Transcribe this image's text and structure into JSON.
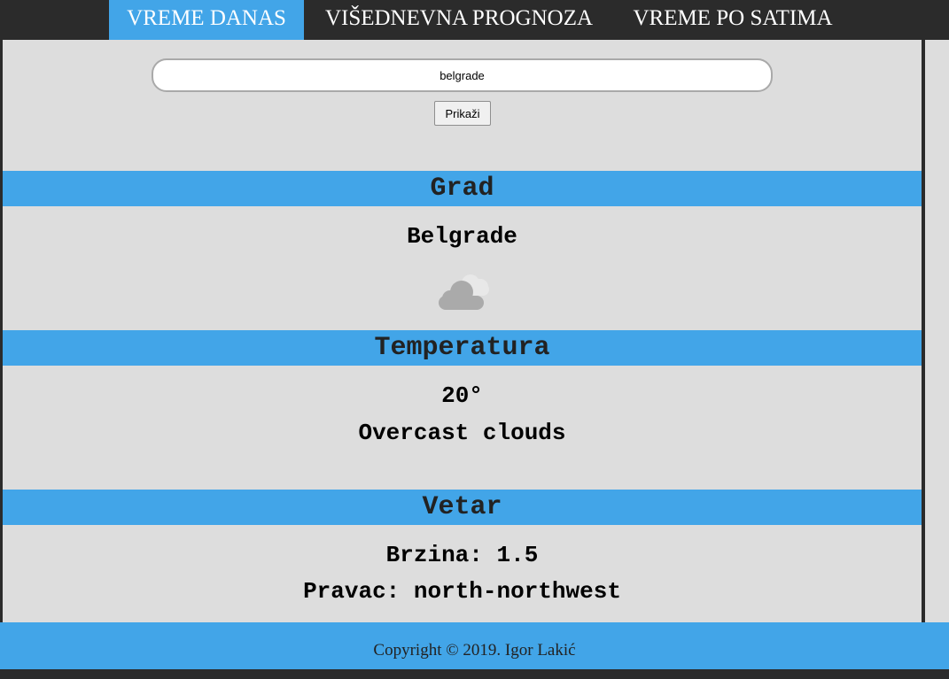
{
  "nav": {
    "tabs": [
      {
        "label": "VREME DANAS",
        "active": true
      },
      {
        "label": "VIŠEDNEVNA PROGNOZA",
        "active": false
      },
      {
        "label": "VREME PO SATIMA",
        "active": false
      }
    ]
  },
  "search": {
    "value": "belgrade",
    "button_label": "Prikaži"
  },
  "sections": {
    "city": {
      "heading": "Grad",
      "name": "Belgrade",
      "icon": "overcast-cloud-icon"
    },
    "temperature": {
      "heading": "Temperatura",
      "value": "20°",
      "description": "Overcast clouds"
    },
    "wind": {
      "heading": "Vetar",
      "speed": "Brzina: 1.5",
      "direction": "Pravac: north-northwest"
    }
  },
  "footer": {
    "text": "Copyright © 2019. Igor Lakić"
  },
  "colors": {
    "accent": "#42a5e8",
    "nav_bg": "#2b2b2b",
    "content_bg": "#dddddd"
  }
}
